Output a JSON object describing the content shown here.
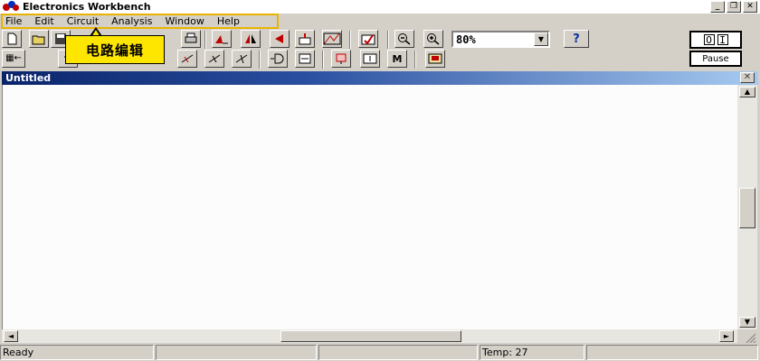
{
  "window": {
    "title": "Electronics Workbench",
    "min_label": "_",
    "max_label": "❐",
    "close_label": "✕"
  },
  "menu": {
    "items": [
      "File",
      "Edit",
      "Circuit",
      "Analysis",
      "Window",
      "Help"
    ]
  },
  "callout": {
    "text": "电路编辑"
  },
  "toolbar": {
    "zoom_value": "80%",
    "zoom_arrow": "▼",
    "help_label": "?",
    "power_off": "O",
    "power_on": "I",
    "pause_label": "Pause"
  },
  "toolbar2": {
    "parts_bin_label": "▦←",
    "meter_label": "M"
  },
  "document": {
    "title": "Untitled",
    "close_label": "✕"
  },
  "scroll": {
    "up": "▲",
    "down": "▼",
    "left": "◄",
    "right": "►"
  },
  "status": {
    "message": "Ready",
    "temp": "Temp:  27"
  }
}
